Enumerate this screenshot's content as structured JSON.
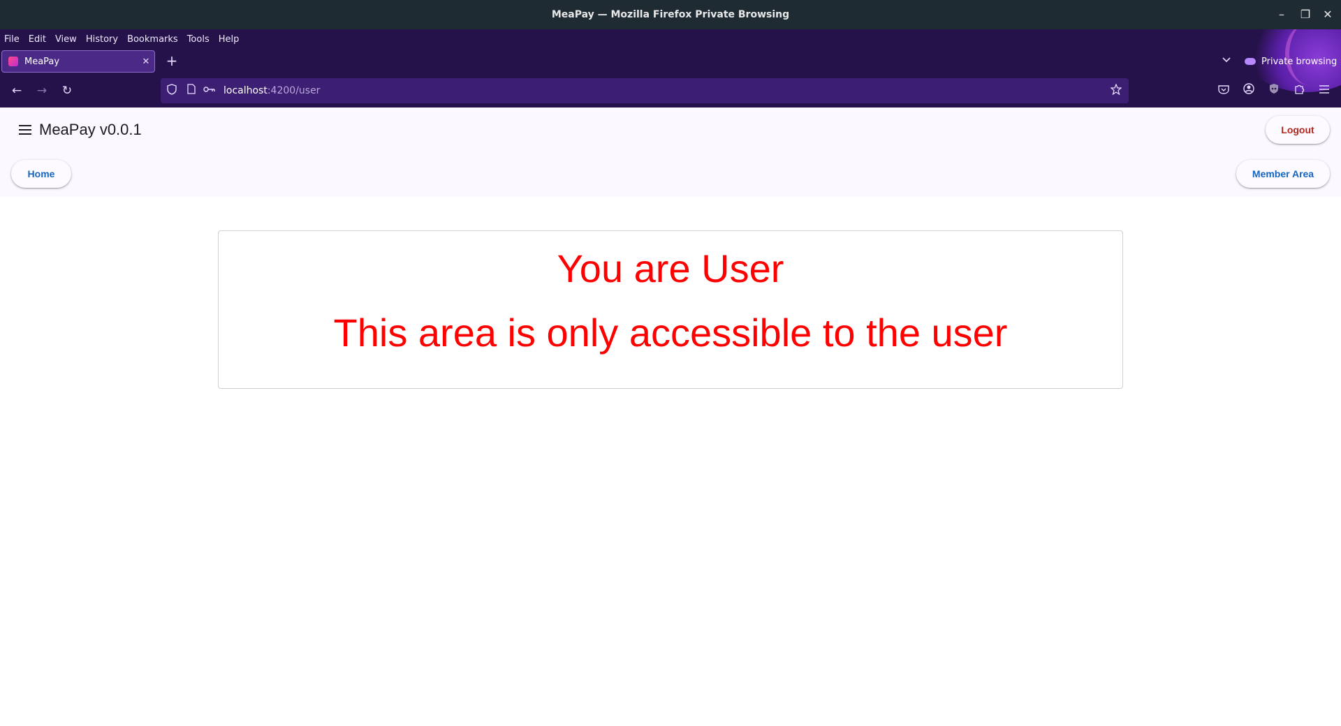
{
  "window": {
    "title": "MeaPay — Mozilla Firefox Private Browsing",
    "minimize": "–",
    "restore": "❐",
    "close": "✕"
  },
  "menubar": [
    "File",
    "Edit",
    "View",
    "History",
    "Bookmarks",
    "Tools",
    "Help"
  ],
  "tab": {
    "title": "MeaPay",
    "close": "✕",
    "new_tab": "+"
  },
  "private_label": "Private browsing",
  "nav": {
    "back": "←",
    "forward": "→",
    "reload": "↻"
  },
  "url": {
    "host": "localhost",
    "path": ":4200/user"
  },
  "app": {
    "title": "MeaPay v0.0.1",
    "logout": "Logout",
    "home": "Home",
    "member_area": "Member Area"
  },
  "content": {
    "heading": "You are User",
    "message": "This area is only accessible to the user"
  },
  "colors": {
    "message": "#ff0000",
    "primary": "#1565c0",
    "logout": "#b3261e"
  }
}
